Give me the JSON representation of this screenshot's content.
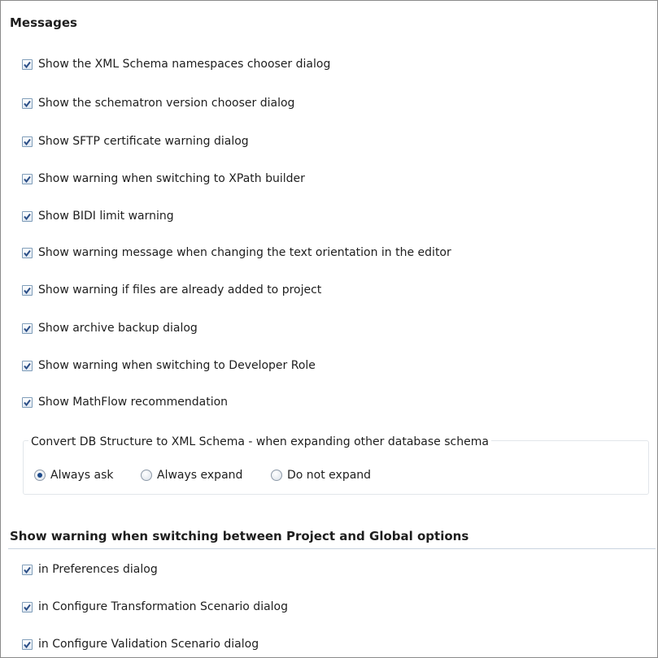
{
  "messages": {
    "title": "Messages",
    "checkboxes": [
      {
        "label": "Show the XML Schema namespaces chooser dialog",
        "checked": true
      },
      {
        "label": "Show the schematron version chooser dialog",
        "checked": true
      },
      {
        "label": "Show SFTP certificate warning dialog",
        "checked": true
      },
      {
        "label": "Show warning when switching to XPath builder",
        "checked": true
      },
      {
        "label": "Show BIDI limit warning",
        "checked": true
      },
      {
        "label": "Show warning message when changing the text orientation in the editor",
        "checked": true
      },
      {
        "label": "Show warning if files are already added to project",
        "checked": true
      },
      {
        "label": "Show archive backup dialog",
        "checked": true
      },
      {
        "label": "Show warning when switching to Developer Role",
        "checked": true
      },
      {
        "label": "Show MathFlow recommendation",
        "checked": true
      }
    ]
  },
  "convert_group": {
    "title": "Convert DB Structure to XML Schema - when expanding other database schema",
    "options": [
      {
        "label": "Always ask",
        "selected": true
      },
      {
        "label": "Always expand",
        "selected": false
      },
      {
        "label": "Do not expand",
        "selected": false
      }
    ]
  },
  "project_global": {
    "title": "Show warning when switching between Project and Global options",
    "checkboxes": [
      {
        "label": "in Preferences dialog",
        "checked": true
      },
      {
        "label": "in Configure Transformation Scenario dialog",
        "checked": true
      },
      {
        "label": "in Configure Validation Scenario dialog",
        "checked": true
      }
    ]
  },
  "colors": {
    "check_mark": "#2b4e86",
    "checkbox_border": "#7f9db9",
    "radio_dot": "#1d4a8a",
    "separator": "#c9d3df"
  }
}
